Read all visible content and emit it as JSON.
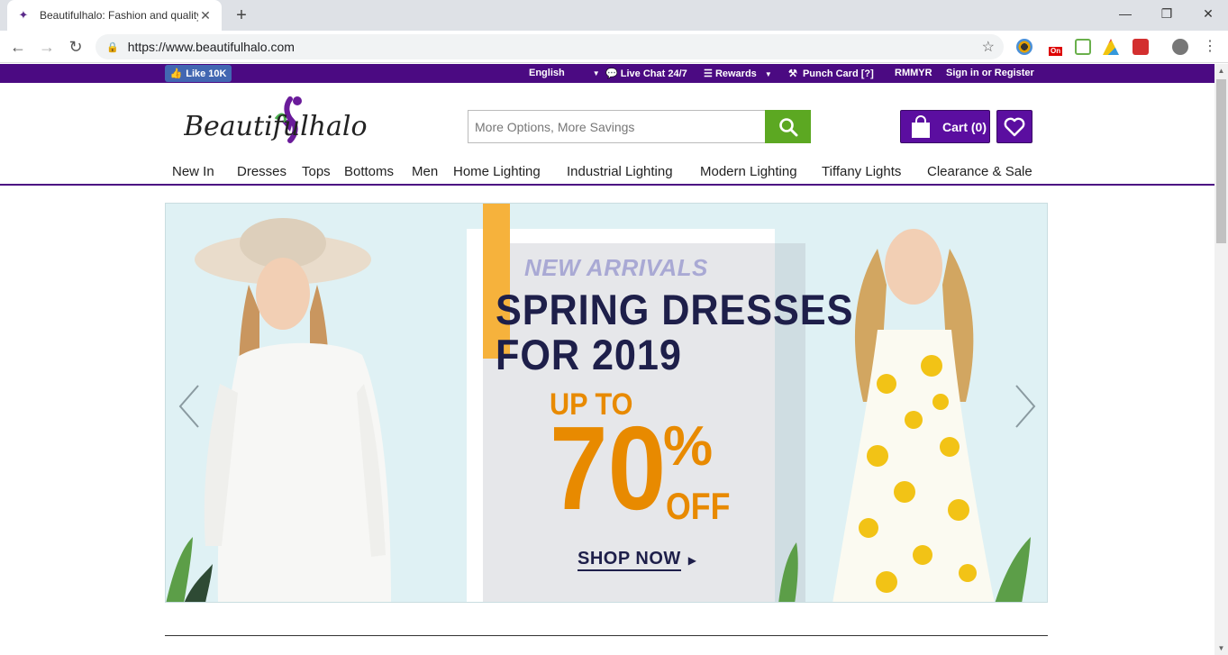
{
  "browser": {
    "tab_title": "Beautifulhalo: Fashion and quality",
    "url": "https://www.beautifulhalo.com",
    "ext_on_badge": "On"
  },
  "topbar": {
    "fb_like": "Like 10K",
    "language": "English",
    "live_chat": "Live Chat 24/7",
    "rewards": "Rewards",
    "punch_card": "Punch Card [?]",
    "currency": "RMMYR",
    "sign_in": "Sign in or Register"
  },
  "header": {
    "logo_text": "Beautifulhalo",
    "search_placeholder": "More Options, More Savings",
    "cart_label": "Cart (0)"
  },
  "nav": {
    "items": [
      "New In",
      "Dresses",
      "Tops",
      "Bottoms",
      "Men",
      "Home Lighting",
      "Industrial Lighting",
      "Modern Lighting",
      "Tiffany Lights",
      "Clearance & Sale"
    ]
  },
  "banner": {
    "tagline": "NEW ARRIVALS",
    "headline_1": "SPRING DRESSES",
    "headline_2": "FOR 2019",
    "up_to": "UP TO",
    "percent": "70",
    "percent_sign": "%",
    "off": "OFF",
    "cta": "SHOP NOW"
  },
  "colors": {
    "brand_purple": "#4b0a82",
    "search_green": "#5ca822",
    "accent_orange": "#e88a00"
  }
}
